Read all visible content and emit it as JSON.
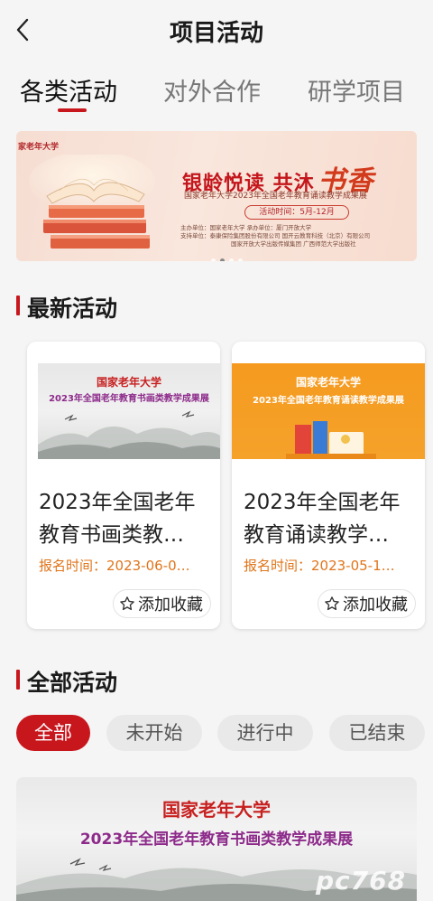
{
  "header": {
    "title": "项目活动"
  },
  "tabs": [
    {
      "label": "各类活动"
    },
    {
      "label": "对外合作"
    },
    {
      "label": "研学项目"
    }
  ],
  "banner": {
    "org": "家老年大学",
    "headline": "银龄悦读 共沐",
    "headline_art": "书香",
    "subtitle": "国家老年大学2023年全国老年教育诵读教学成果展",
    "time": "活动时间：5月-12月",
    "info_line1": "主办单位：国家老年大学    承办单位：厦门开放大学",
    "info_line2": "支持单位：泰康保险集团股份有限公司    国开云教育科技（北京）有限公司",
    "info_line3": "国家开放大学出版传媒集团    广西师范大学出版社"
  },
  "latest": {
    "title": "最新活动",
    "cards": [
      {
        "image_title": "国家老年大学",
        "image_subtitle": "2023年全国老年教育书画类教学成果展",
        "title": "2023年全国老年教育书画类教…",
        "time": "报名时间：2023-06-0…",
        "fav_label": "添加收藏"
      },
      {
        "image_title": "国家老年大学",
        "image_subtitle": "2023年全国老年教育诵读教学成果展",
        "title": "2023年全国老年教育诵读教学…",
        "time": "报名时间：2023-05-1…",
        "fav_label": "添加收藏"
      }
    ]
  },
  "all": {
    "title": "全部活动",
    "filters": [
      {
        "label": "全部"
      },
      {
        "label": "未开始"
      },
      {
        "label": "进行中"
      },
      {
        "label": "已结束"
      }
    ],
    "list_item": {
      "image_title": "国家老年大学",
      "image_subtitle": "2023年全国老年教育书画类教学成果展"
    }
  },
  "watermark": "pc768",
  "colors": {
    "accent": "#c8161d",
    "time_text": "#e0751a"
  }
}
